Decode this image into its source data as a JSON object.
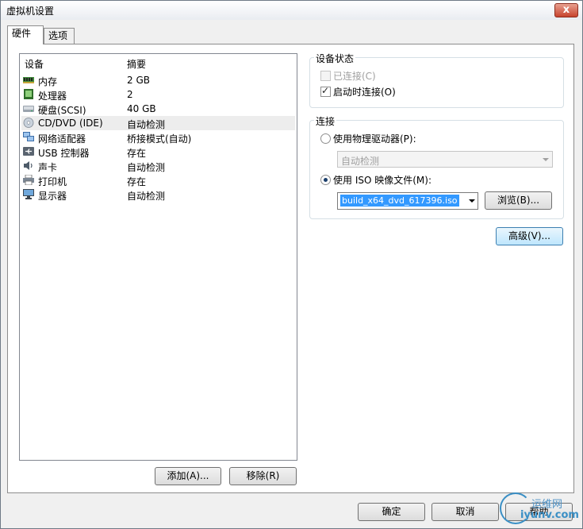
{
  "window": {
    "title": "虚拟机设置",
    "close_glyph": "x"
  },
  "tabs": [
    {
      "label": "硬件"
    },
    {
      "label": "选项"
    }
  ],
  "list": {
    "col_device": "设备",
    "col_summary": "摘要",
    "rows": [
      {
        "name": "内存",
        "summary": "2 GB",
        "icon": "memory-icon"
      },
      {
        "name": "处理器",
        "summary": "2",
        "icon": "processor-icon"
      },
      {
        "name": "硬盘(SCSI)",
        "summary": "40 GB",
        "icon": "harddisk-icon"
      },
      {
        "name": "CD/DVD (IDE)",
        "summary": "自动检测",
        "icon": "cd-dvd-icon"
      },
      {
        "name": "网络适配器",
        "summary": "桥接模式(自动)",
        "icon": "network-adapter-icon"
      },
      {
        "name": "USB 控制器",
        "summary": "存在",
        "icon": "usb-icon"
      },
      {
        "name": "声卡",
        "summary": "自动检测",
        "icon": "sound-card-icon"
      },
      {
        "name": "打印机",
        "summary": "存在",
        "icon": "printer-icon"
      },
      {
        "name": "显示器",
        "summary": "自动检测",
        "icon": "display-icon"
      }
    ],
    "selected_index": 3
  },
  "buttons": {
    "add": "添加(A)...",
    "remove": "移除(R)",
    "browse": "浏览(B)...",
    "advanced": "高级(V)...",
    "ok": "确定",
    "cancel": "取消",
    "help": "帮助"
  },
  "device_status": {
    "title": "设备状态",
    "connected": {
      "label": "已连接(C)",
      "checked": false,
      "enabled": false
    },
    "connect_at_power_on": {
      "label": "启动时连接(O)",
      "checked": true,
      "enabled": true
    }
  },
  "connection": {
    "title": "连接",
    "physical": {
      "label": "使用物理驱动器(P):",
      "selected": false
    },
    "physical_value": "自动检测",
    "iso": {
      "label": "使用 ISO 映像文件(M):",
      "selected": true
    },
    "iso_path": "build_x64_dvd_617396.iso"
  },
  "watermark": {
    "line1": "运维网",
    "line2": "iyunv.com"
  },
  "colors": {
    "selection": "#3399ff",
    "accent": "#3c7fb1"
  }
}
